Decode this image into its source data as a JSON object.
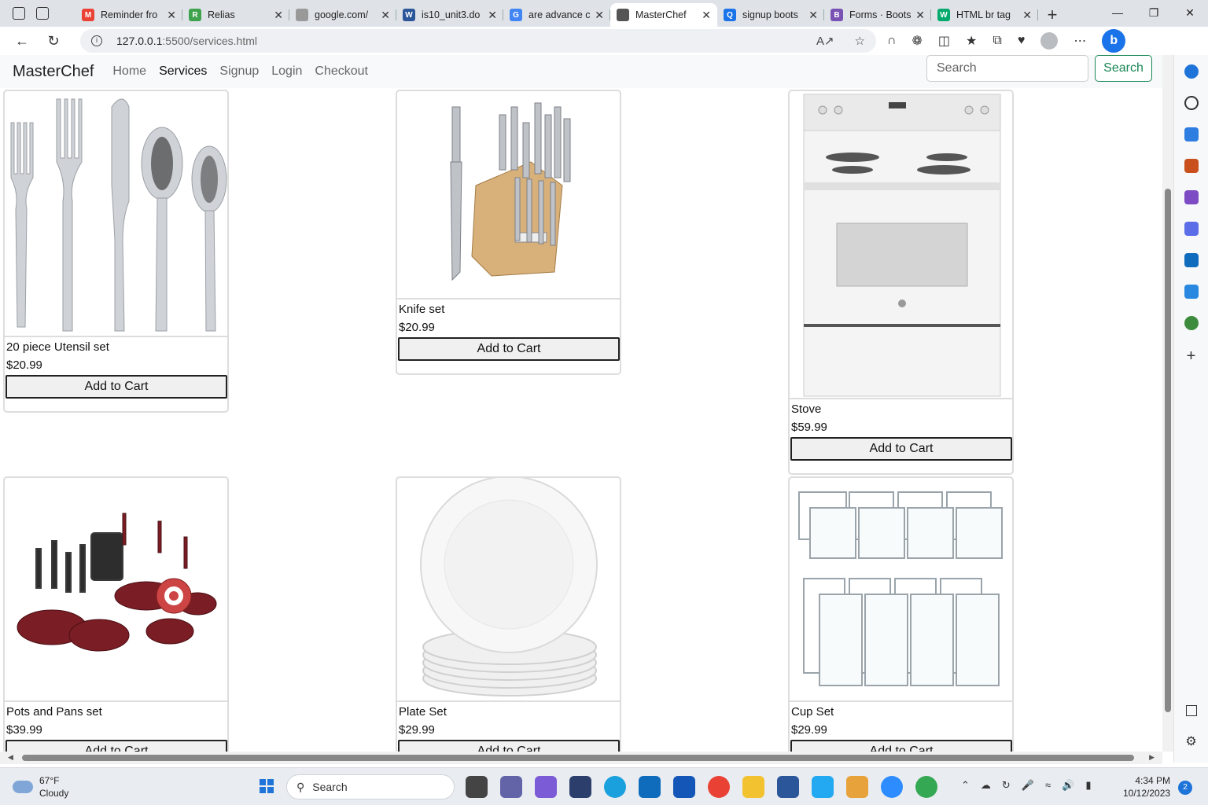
{
  "browser": {
    "tabs": [
      {
        "title": "Reminder fro",
        "fav_color": "#ea4335",
        "fav_letter": "M"
      },
      {
        "title": "Relias",
        "fav_color": "#3fa34d",
        "fav_letter": "R"
      },
      {
        "title": "google.com/",
        "fav_color": "#999999",
        "fav_letter": ""
      },
      {
        "title": "is10_unit3.do",
        "fav_color": "#2b579a",
        "fav_letter": "W"
      },
      {
        "title": "are advance c",
        "fav_color": "#4285f4",
        "fav_letter": "G"
      },
      {
        "title": "MasterChef",
        "fav_color": "#555555",
        "fav_letter": ""
      },
      {
        "title": "signup boots",
        "fav_color": "#1a73e8",
        "fav_letter": "Q"
      },
      {
        "title": "Forms · Boots",
        "fav_color": "#7952b3",
        "fav_letter": "B"
      },
      {
        "title": "HTML br tag",
        "fav_color": "#04aa6d",
        "fav_letter": "W"
      }
    ],
    "active_tab": 5,
    "url_host": "127.0.0.1",
    "url_rest": ":5500/services.html"
  },
  "site": {
    "brand": "MasterChef",
    "nav": [
      "Home",
      "Services",
      "Signup",
      "Login",
      "Checkout"
    ],
    "active_nav": "Services",
    "search_placeholder": "Search",
    "search_button": "Search"
  },
  "products": [
    {
      "name": "20 piece Utensil set",
      "price": "$20.99",
      "button": "Add to Cart",
      "image": "utensils"
    },
    {
      "name": "Knife set",
      "price": "$20.99",
      "button": "Add to Cart",
      "image": "knife-block"
    },
    {
      "name": "Stove",
      "price": "$59.99",
      "button": "Add to Cart",
      "image": "stove"
    },
    {
      "name": "Pots and Pans set",
      "price": "$39.99",
      "button": "Add to Cart",
      "image": "pots-pans"
    },
    {
      "name": "Plate Set",
      "price": "$29.99",
      "button": "Add to Cart",
      "image": "plates"
    },
    {
      "name": "Cup Set",
      "price": "$29.99",
      "button": "Add to Cart",
      "image": "cups"
    }
  ],
  "taskbar": {
    "temp": "67°F",
    "condition": "Cloudy",
    "search": "Search",
    "time": "4:34 PM",
    "date": "10/12/2023",
    "notifications": "2"
  }
}
